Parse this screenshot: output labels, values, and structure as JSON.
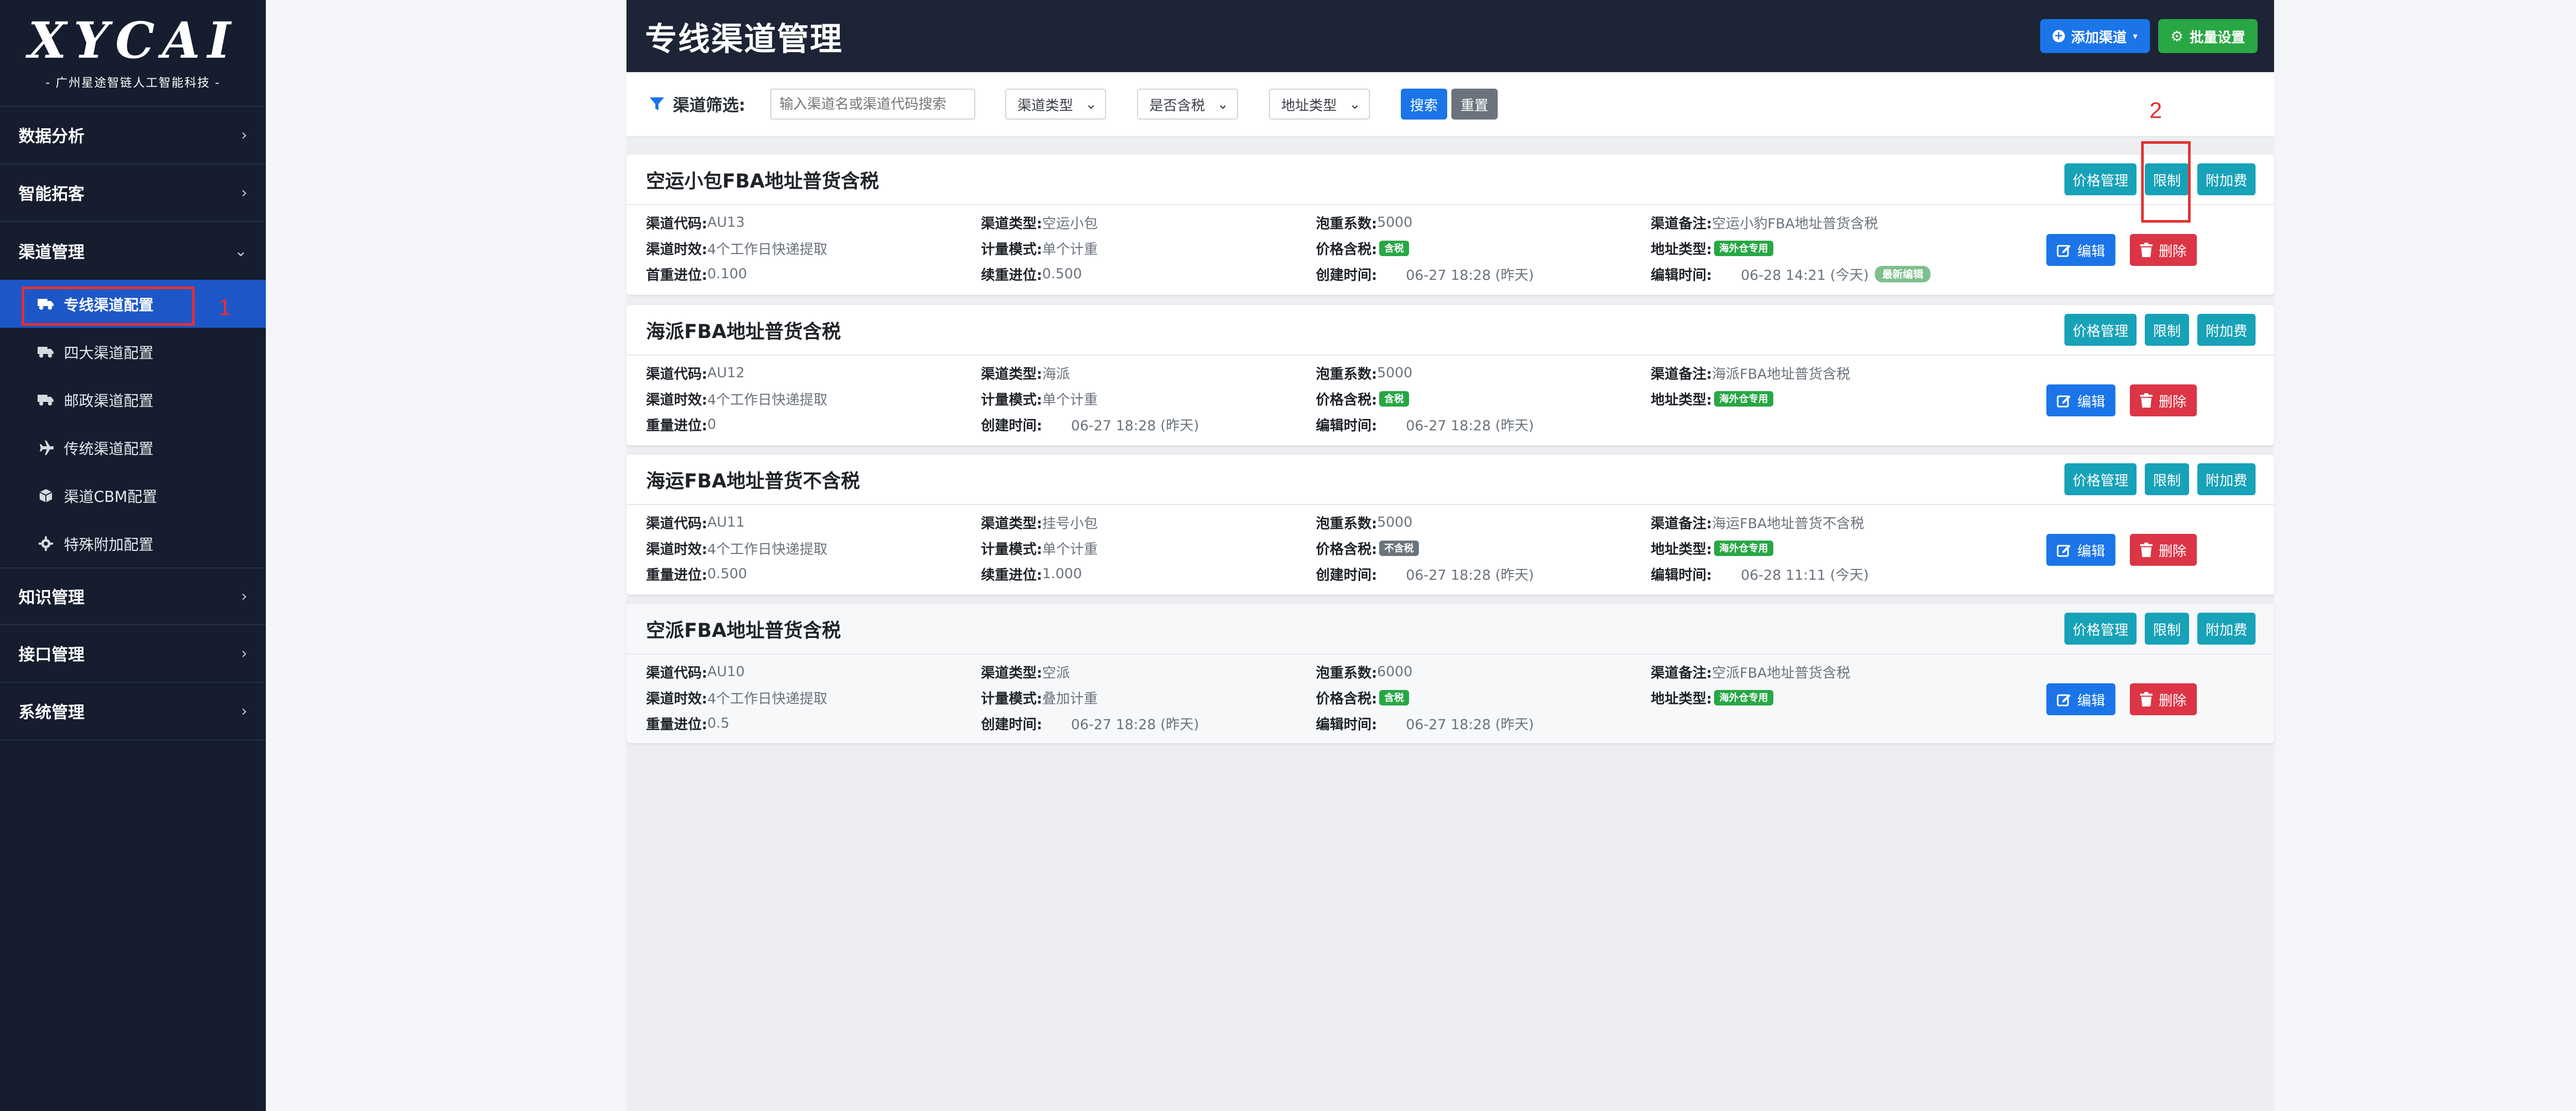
{
  "sidebar": {
    "logo": "XYCAI",
    "logo_sub": "- 广州星途智链人工智能科技 -",
    "groups": [
      {
        "label": "数据分析"
      },
      {
        "label": "智能拓客"
      },
      {
        "label": "渠道管理"
      },
      {
        "label": "知识管理"
      },
      {
        "label": "接口管理"
      },
      {
        "label": "系统管理"
      }
    ],
    "channel_items": [
      {
        "label": "专线渠道配置",
        "icon": "truck-icon",
        "active": true
      },
      {
        "label": "四大渠道配置",
        "icon": "truck-icon"
      },
      {
        "label": "邮政渠道配置",
        "icon": "truck-icon"
      },
      {
        "label": "传统渠道配置",
        "icon": "plane-icon"
      },
      {
        "label": "渠道CBM配置",
        "icon": "cube-icon"
      },
      {
        "label": "特殊附加配置",
        "icon": "gear-icon"
      }
    ]
  },
  "annotations": {
    "one": "1",
    "two": "2"
  },
  "header": {
    "title": "专线渠道管理",
    "add_label": "添加渠道",
    "batch_label": "批量设置"
  },
  "filter": {
    "label": "渠道筛选:",
    "search_placeholder": "输入渠道名或渠道代码搜索",
    "type_select": "渠道类型",
    "tax_select": "是否含税",
    "address_select": "地址类型",
    "search_label": "搜索",
    "reset_label": "重置"
  },
  "card_buttons": {
    "price": "价格管理",
    "limit": "限制",
    "extra": "附加费",
    "edit": "编辑",
    "delete": "删除"
  },
  "labels": {
    "code": "渠道代码:",
    "type": "渠道类型:",
    "ratio": "泡重系数:",
    "remark": "渠道备注:",
    "time": "渠道时效:",
    "mode": "计量模式:",
    "tax": "价格含税:",
    "addr": "地址类型:",
    "first": "首重进位:",
    "cont": "续重进位:",
    "weight": "重量进位:",
    "created": "创建时间:",
    "edited": "编辑时间:"
  },
  "channels": [
    {
      "title": "空运小包FBA地址普货含税",
      "code": "AU13",
      "type": "空运小包",
      "ratio": "5000",
      "remark": "空运小豹FBA地址普货含税",
      "time": "4个工作日快递提取",
      "mode": "单个计重",
      "tax_badge": "含税",
      "addr_badge": "海外仓专用",
      "first": "0.100",
      "cont": "0.500",
      "created": "06-27 18:28 (昨天)",
      "edited": "06-28 14:21 (今天)",
      "recent_badge": "最新编辑"
    },
    {
      "title": "海派FBA地址普货含税",
      "code": "AU12",
      "type": "海派",
      "ratio": "5000",
      "remark": "海派FBA地址普货含税",
      "time": "4个工作日快递提取",
      "mode": "单个计重",
      "tax_badge": "含税",
      "addr_badge": "海外仓专用",
      "weight": "0",
      "created": "06-27 18:28 (昨天)",
      "edited": "06-27 18:28 (昨天)"
    },
    {
      "title": "海运FBA地址普货不含税",
      "code": "AU11",
      "type": "挂号小包",
      "ratio": "5000",
      "remark": "海运FBA地址普货不含税",
      "time": "4个工作日快递提取",
      "mode": "单个计重",
      "tax_badge": "不含税",
      "addr_badge": "海外仓专用",
      "weight": "0.500",
      "cont": "1.000",
      "created": "06-27 18:28 (昨天)",
      "edited": "06-28 11:11 (今天)"
    },
    {
      "title": "空派FBA地址普货含税",
      "code": "AU10",
      "type": "空派",
      "ratio": "6000",
      "remark": "空派FBA地址普货含税",
      "time": "4个工作日快递提取",
      "mode": "叠加计重",
      "tax_badge": "含税",
      "addr_badge": "海外仓专用",
      "weight": "0.5",
      "created": "06-27 18:28 (昨天)",
      "edited": "06-27 18:28 (昨天)"
    }
  ]
}
